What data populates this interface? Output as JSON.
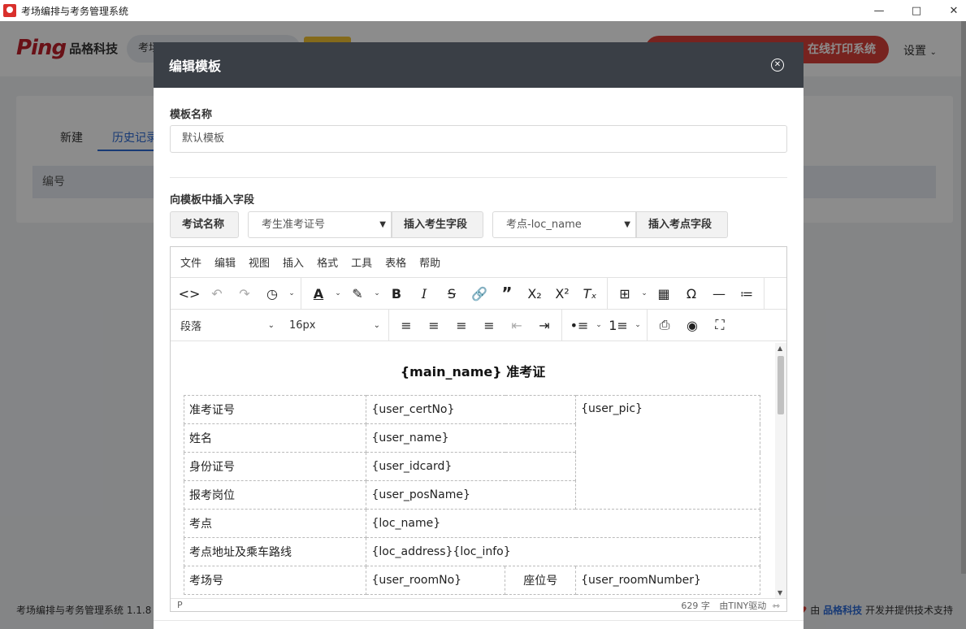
{
  "window": {
    "title": "考场编排与考务管理系统"
  },
  "header": {
    "logo_text": "Ping",
    "brand": "品格科技",
    "search_text": "考场",
    "print_button": "在线打印系统",
    "settings": "设置"
  },
  "tabs": [
    "新建",
    "历史记录"
  ],
  "table": {
    "header": "编号"
  },
  "footer": {
    "left": "考场编排与考务管理系统 1.1.8",
    "right_prefix": "由",
    "brand": "品格科技",
    "right_suffix": "开发并提供技术支持"
  },
  "modal": {
    "title": "编辑模板",
    "name_label": "模板名称",
    "name_value": "默认模板",
    "insert_label": "向模板中插入字段",
    "btn_exam_name": "考试名称",
    "select_user_field": "考生准考证号",
    "btn_insert_user": "插入考生字段",
    "select_loc_field": "考点-loc_name",
    "btn_insert_loc": "插入考点字段"
  },
  "editor": {
    "menu": [
      "文件",
      "编辑",
      "视图",
      "插入",
      "格式",
      "工具",
      "表格",
      "帮助"
    ],
    "block_format": "段落",
    "font_size": "16px",
    "status_path": "P",
    "word_count": "629 字",
    "powered": "由TINY驱动"
  },
  "doc": {
    "title": "{main_name} 准考证",
    "rows": [
      {
        "label": "准考证号",
        "value": "{user_certNo}"
      },
      {
        "label": "姓名",
        "value": "{user_name}"
      },
      {
        "label": "身份证号",
        "value": "{user_idcard}"
      },
      {
        "label": "报考岗位",
        "value": "{user_posName}"
      }
    ],
    "pic": "{user_pic}",
    "loc_label": "考点",
    "loc_value": "{loc_name}",
    "addr_label": "考点地址及乘车路线",
    "addr_value": "{loc_address}{loc_info}",
    "room_label": "考场号",
    "room_value": "{user_roomNo}",
    "seat_label": "座位号",
    "seat_value": "{user_roomNumber}"
  }
}
